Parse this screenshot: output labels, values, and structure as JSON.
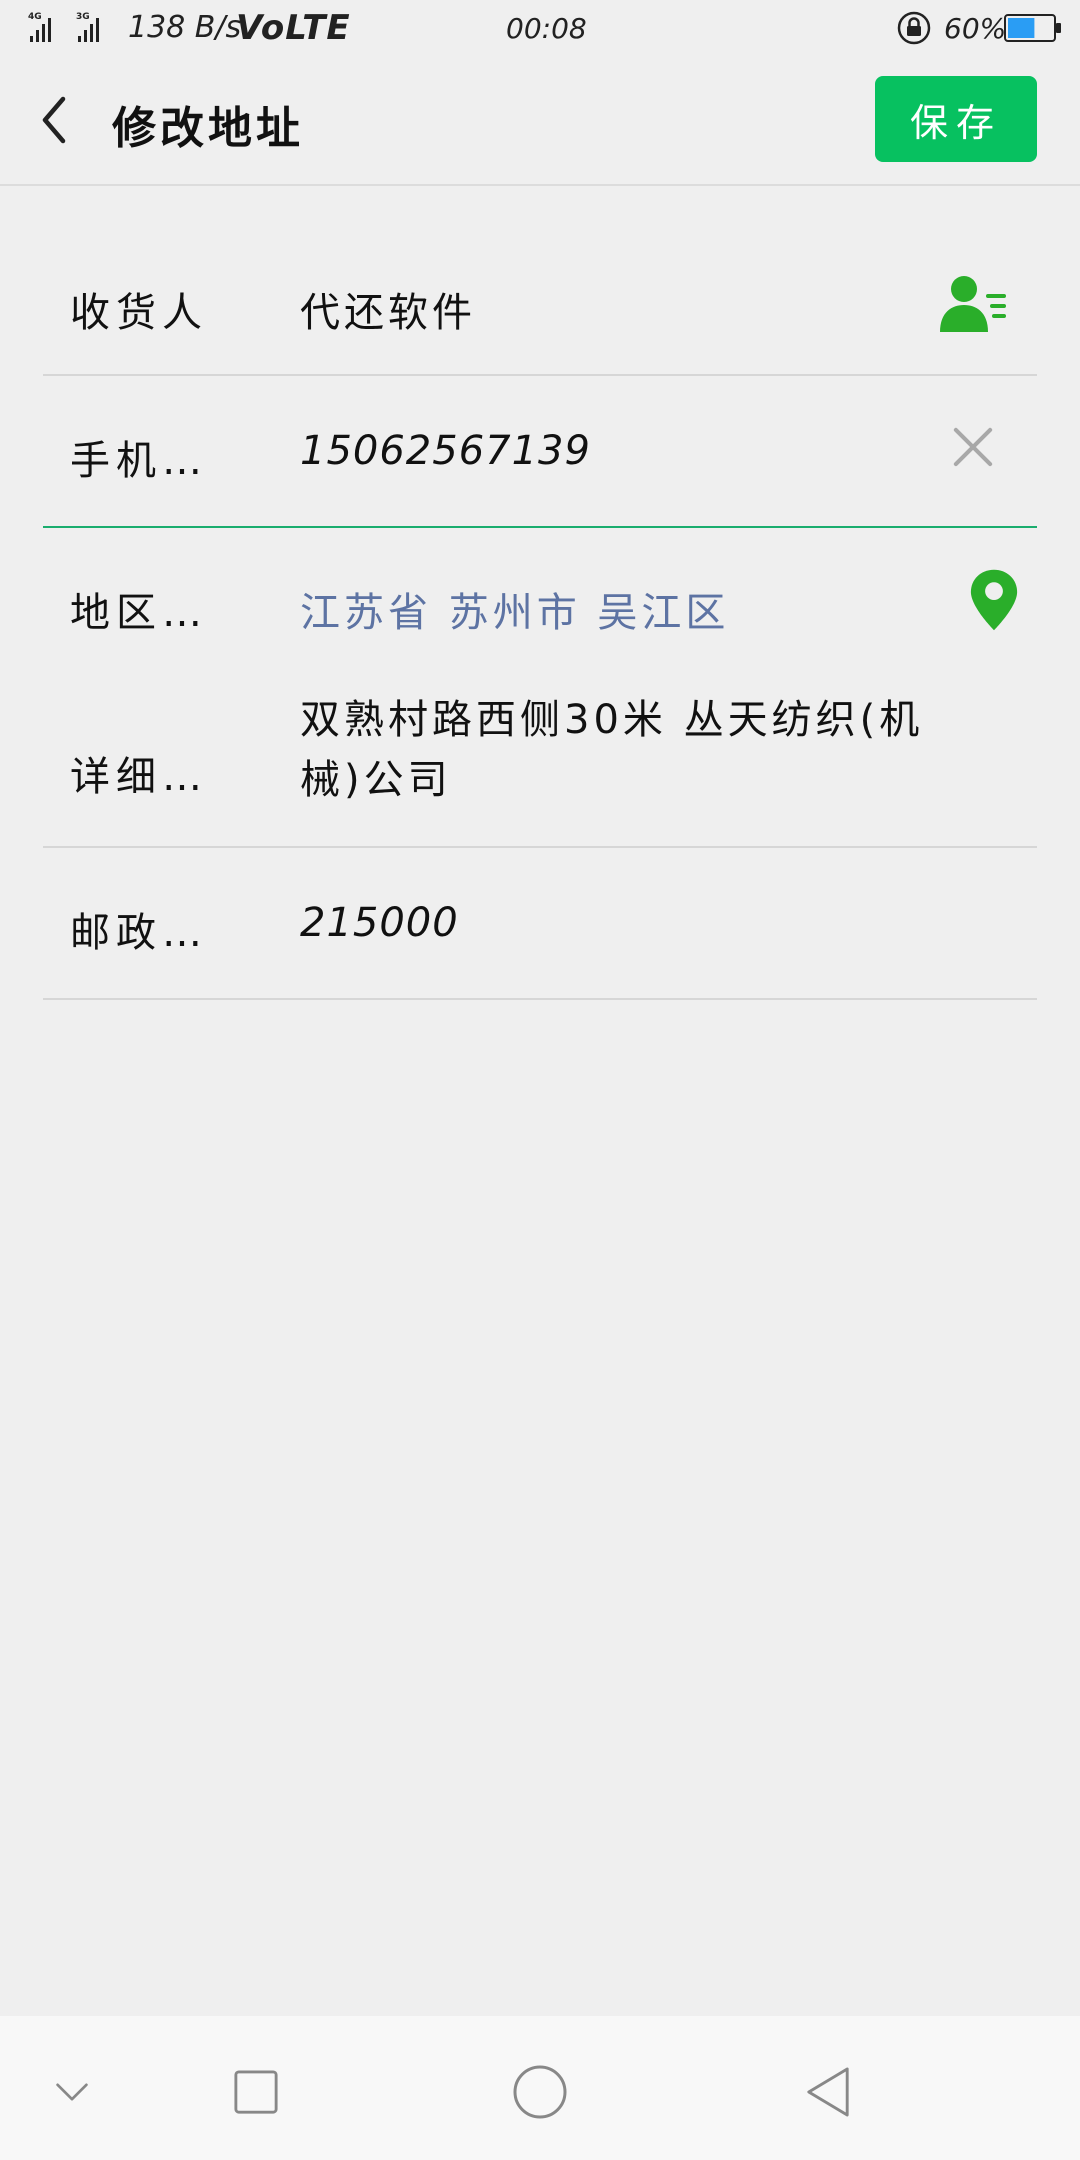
{
  "status_bar": {
    "network": "4G 3G",
    "speed": "138 B/s",
    "volte": "VoLTE",
    "time": "00:08",
    "battery_percent": "60%",
    "battery_level": 0.6,
    "icons": [
      "signal-icon",
      "rotation-lock-icon",
      "battery-icon"
    ]
  },
  "header": {
    "title": "修改地址",
    "save_label": "保存",
    "accent_color": "#07c160"
  },
  "form": {
    "name": {
      "label": "收货人",
      "value": "代还软件"
    },
    "phone": {
      "label": "手机…",
      "value": "15062567139"
    },
    "region": {
      "label": "地区…",
      "value": "江苏省 苏州市 吴江区"
    },
    "detail": {
      "label": "详细…",
      "value": "双熟村路西侧30米 丛天纺织(机械)公司"
    },
    "zip": {
      "label": "邮政…",
      "value": "215000"
    }
  },
  "nav": {
    "icons": [
      "chevron-down-icon",
      "recent-apps-icon",
      "home-icon",
      "back-triangle-icon"
    ]
  }
}
